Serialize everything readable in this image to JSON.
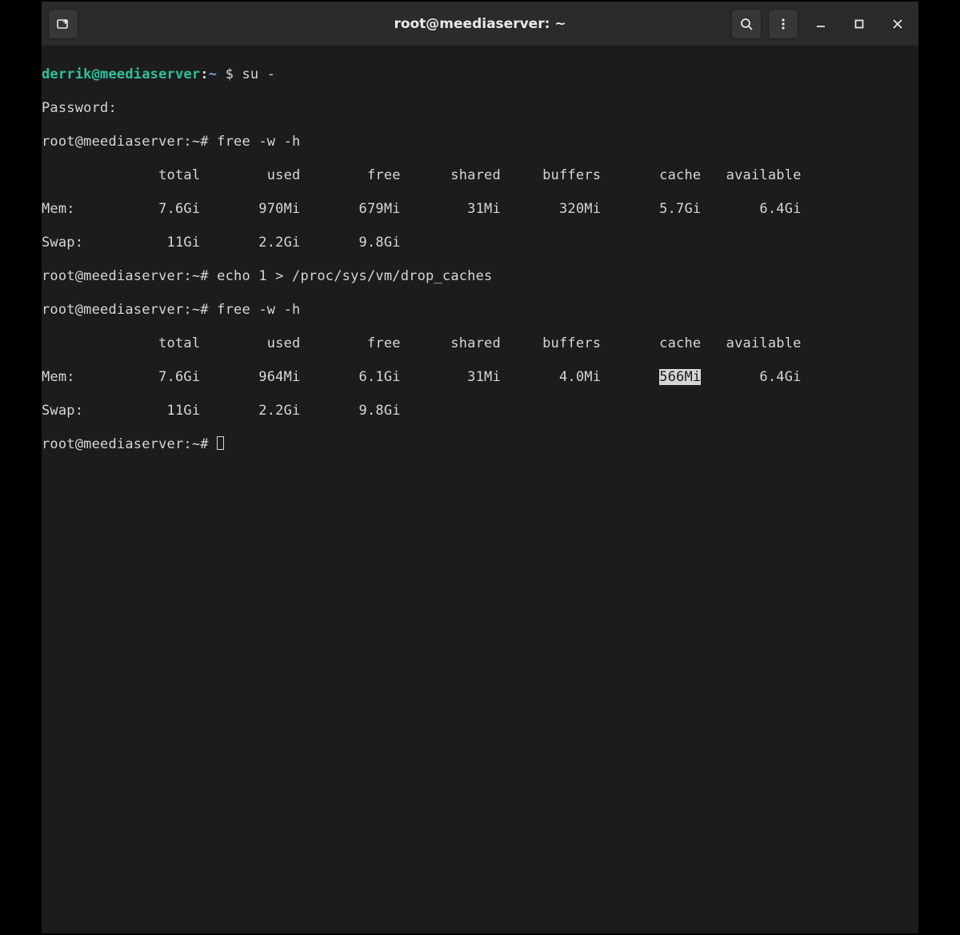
{
  "titlebar": {
    "title": "root@meediaserver: ~"
  },
  "session": {
    "user_prompt_user": "derrik@meediaserver",
    "user_prompt_sep": ":",
    "user_prompt_path": "~",
    "user_prompt_symbol": "$",
    "root_prompt": "root@meediaserver:~#",
    "cmd1": "su -",
    "password_label": "Password:",
    "cmd2": "free -w -h",
    "cmd3": "echo 1 > /proc/sys/vm/drop_caches",
    "cmd4": "free -w -h"
  },
  "free1": {
    "header": "              total        used        free      shared     buffers       cache   available",
    "mem": "Mem:          7.6Gi       970Mi       679Mi        31Mi       320Mi       5.7Gi       6.4Gi",
    "swap": "Swap:          11Gi       2.2Gi       9.8Gi"
  },
  "free2": {
    "header": "              total        used        free      shared     buffers       cache   available",
    "mem_pre": "Mem:          7.6Gi       964Mi       6.1Gi        31Mi       4.0Mi       ",
    "mem_sel": "566Mi",
    "mem_post": "       6.4Gi",
    "swap": "Swap:          11Gi       2.2Gi       9.8Gi"
  }
}
